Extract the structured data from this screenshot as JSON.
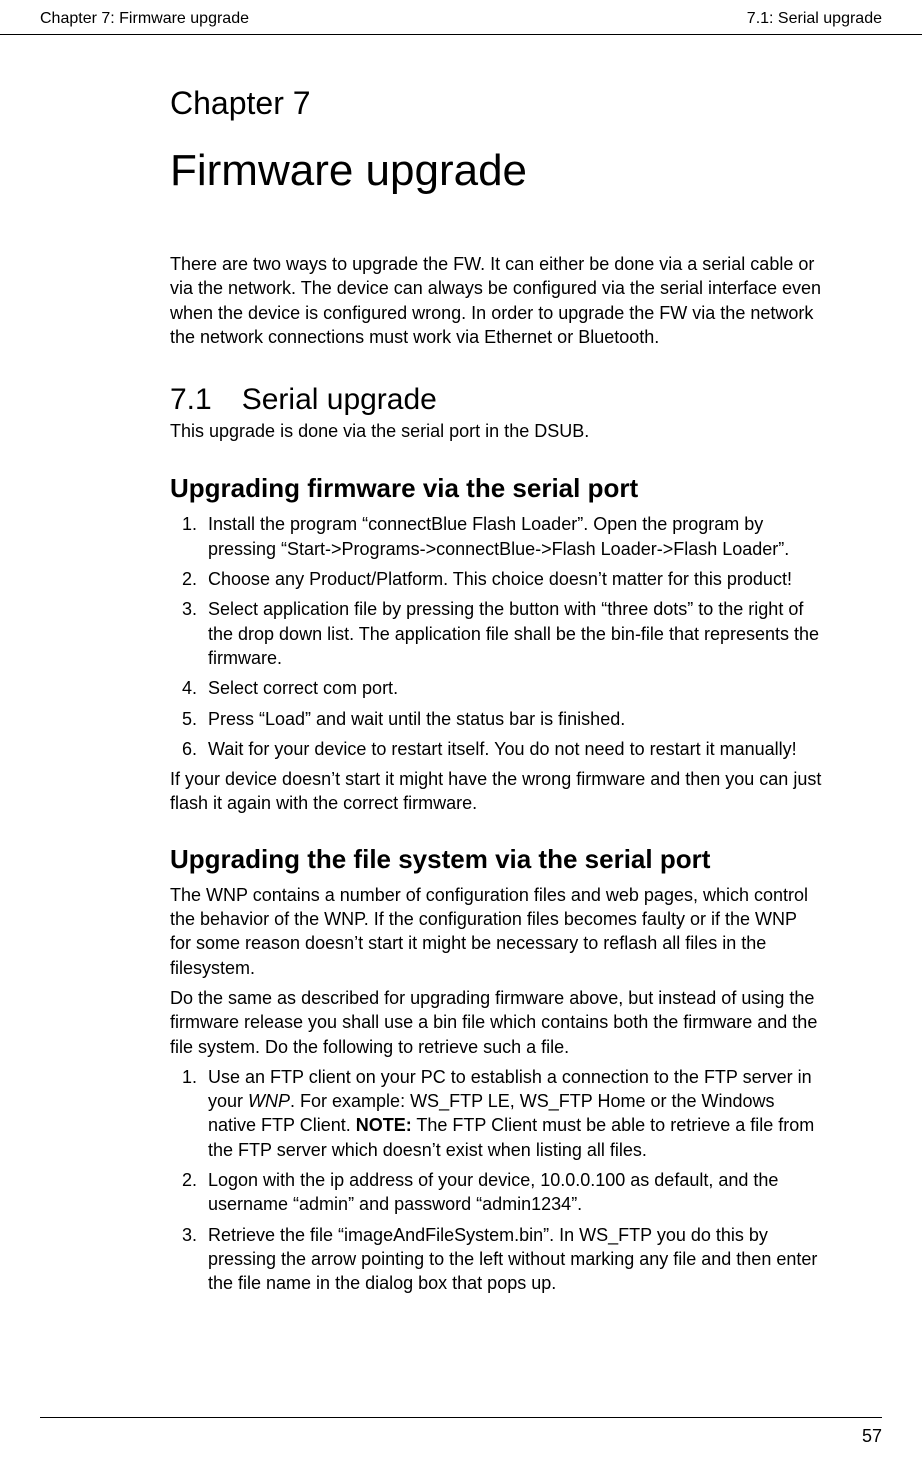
{
  "header": {
    "left": "Chapter 7: Firmware upgrade",
    "right": "7.1: Serial upgrade"
  },
  "chapter": {
    "num": "Chapter 7",
    "title": "Firmware upgrade",
    "intro": "There are two ways to upgrade the FW. It can either be done via a serial cable or via the network. The device can always be configured via the serial interface even when the device is configured wrong. In order to upgrade the FW via the network the network connections must work via Ethernet or Bluetooth."
  },
  "section": {
    "num": "7.1",
    "title": "Serial upgrade",
    "sub": "This upgrade is done via the serial port in the DSUB."
  },
  "fw": {
    "heading": "Upgrading firmware via the serial port",
    "steps": [
      "Install the program “connectBlue Flash Loader”. Open the program by pressing “Start->Programs->connectBlue->Flash Loader->Flash Loader”.",
      "Choose any Product/Platform. This choice doesn’t matter for this product!",
      "Select application file by pressing the button with “three dots” to the right of the drop down list. The application file shall be the bin-file that represents the firmware.",
      "Select correct com port.",
      "Press “Load” and wait until the status bar is finished.",
      "Wait for your device to restart itself. You do not need to restart it manually!"
    ],
    "after": "If your device doesn’t start it might have the wrong firmware and then you can just flash it again with the correct firmware."
  },
  "fs": {
    "heading": "Upgrading the file system via the serial port",
    "p1": "The WNP contains a number of configuration files and web pages, which control the behavior of the WNP. If the configuration files becomes faulty or if the WNP for some reason doesn’t start it might be necessary to reflash all files in the filesystem.",
    "p2": "Do the same as described for upgrading firmware above, but instead of using the firmware release you shall use a bin file which contains both the firmware and the file system. Do the following to retrieve such a file.",
    "step1_a": "Use an FTP client on your PC to establish a connection to the FTP server in your ",
    "step1_wnp": "WNP",
    "step1_b": ". For example: WS_FTP LE, WS_FTP Home or the Windows native FTP Client. ",
    "step1_note": "NOTE:",
    "step1_c": " The FTP Client must be able to retrieve a file from the FTP server which doesn’t exist when listing all files.",
    "step2": " Logon with the ip address of your device, 10.0.0.100 as default, and the username “admin” and password “admin1234”.",
    "step3": "Retrieve the file “imageAndFileSystem.bin”. In WS_FTP you do this by pressing the arrow pointing to the left without marking any file and then enter the file name in the dialog box that pops up."
  },
  "footer": {
    "page": "57"
  }
}
